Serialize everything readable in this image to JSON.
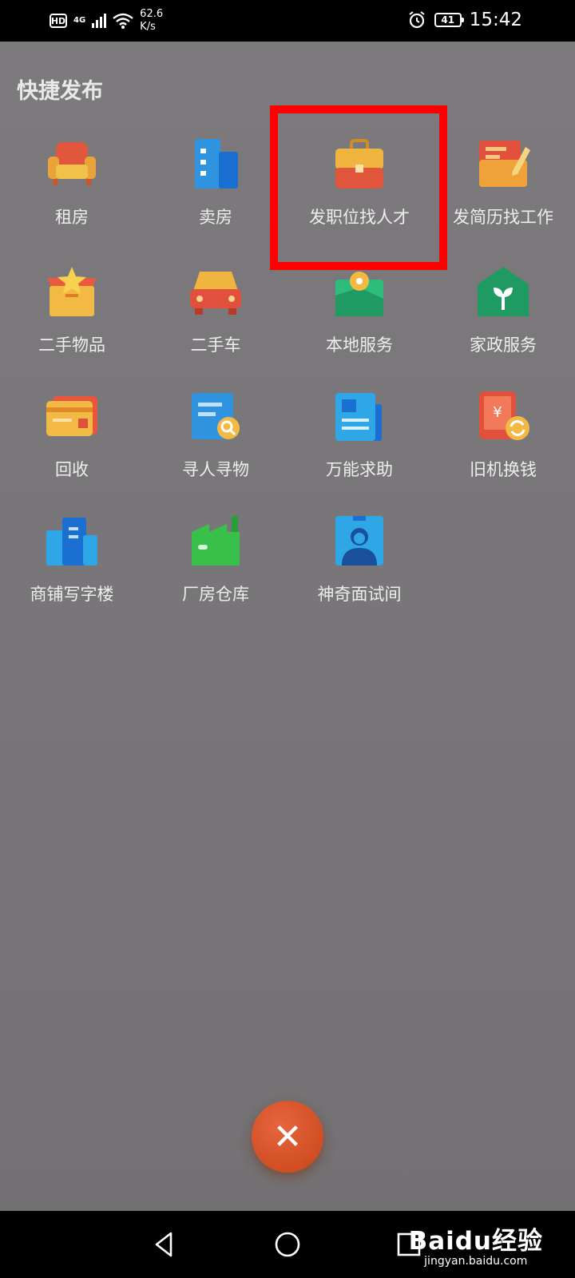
{
  "status": {
    "hd": "HD",
    "network": "4G",
    "speed_value": "62.6",
    "speed_unit": "K/s",
    "battery": "41",
    "time": "15:42"
  },
  "header": {
    "title": "快捷发布"
  },
  "items": [
    {
      "label": "租房",
      "icon": "armchair-icon"
    },
    {
      "label": "卖房",
      "icon": "buildings-icon"
    },
    {
      "label": "发职位找人才",
      "icon": "briefcase-icon"
    },
    {
      "label": "发简历找工作",
      "icon": "resume-pencil-icon"
    },
    {
      "label": "二手物品",
      "icon": "box-star-icon"
    },
    {
      "label": "二手车",
      "icon": "car-icon"
    },
    {
      "label": "本地服务",
      "icon": "location-map-icon"
    },
    {
      "label": "家政服务",
      "icon": "house-sprout-icon"
    },
    {
      "label": "回收",
      "icon": "card-icon"
    },
    {
      "label": "寻人寻物",
      "icon": "search-document-icon"
    },
    {
      "label": "万能求助",
      "icon": "document-icon"
    },
    {
      "label": "旧机换钱",
      "icon": "phone-exchange-icon"
    },
    {
      "label": "商铺写字楼",
      "icon": "office-building-icon"
    },
    {
      "label": "厂房仓库",
      "icon": "factory-icon"
    },
    {
      "label": "神奇面试间",
      "icon": "interviewer-icon"
    }
  ],
  "close_button": {
    "icon": "close-icon",
    "glyph": "✕"
  },
  "watermark": {
    "main": "Baidu经验",
    "sub": "jingyan.baidu.com"
  }
}
